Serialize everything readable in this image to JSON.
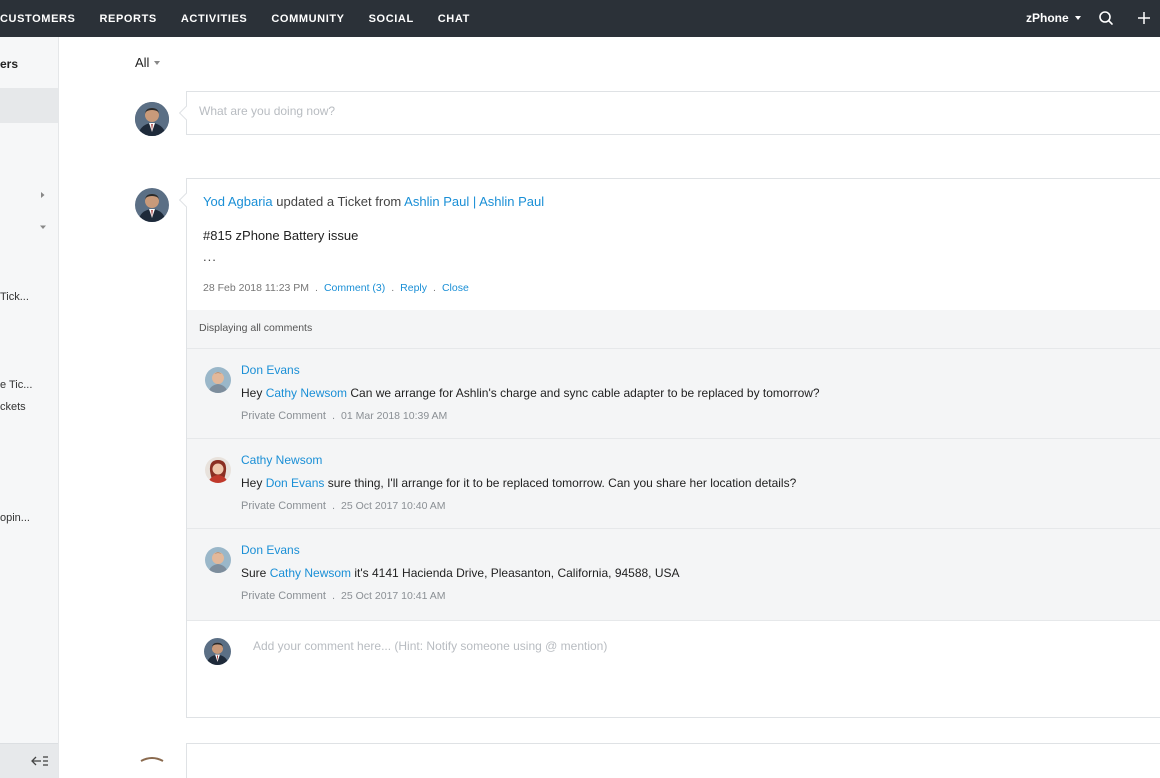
{
  "nav": {
    "items": [
      "CUSTOMERS",
      "REPORTS",
      "ACTIVITIES",
      "COMMUNITY",
      "SOCIAL",
      "CHAT"
    ],
    "brand": "zPhone",
    "icons": [
      "search-icon",
      "plus-icon"
    ]
  },
  "sidebar": {
    "title": "ers",
    "items": [
      "Tick...",
      "e Tic...",
      "ckets",
      "opin..."
    ],
    "collapse_icon": "collapse-sidebar-icon"
  },
  "filter": {
    "label": "All"
  },
  "composer": {
    "placeholder": "What are you doing now?"
  },
  "feed": {
    "actor": "Yod Agbaria",
    "action": " updated a Ticket from ",
    "contact": "Ashlin Paul",
    "separator": " | ",
    "account": "Ashlin Paul",
    "subject": "#815 zPhone Battery issue",
    "ellipsis": "...",
    "timestamp": "28 Feb 2018 11:23 PM",
    "dot": ".",
    "comment_link": "Comment (3)",
    "reply_link": "Reply",
    "close_link": "Close",
    "comments_label": "Displaying all comments",
    "comments": [
      {
        "author": "Don Evans",
        "prefix": "Hey ",
        "mention": "Cathy Newsom",
        "text": " Can we arrange for Ashlin's charge and sync cable adapter to be replaced by tomorrow?",
        "visibility": "Private Comment",
        "dot": ".",
        "time": "01 Mar 2018 10:39 AM"
      },
      {
        "author": "Cathy Newsom",
        "prefix": "Hey ",
        "mention": "Don Evans",
        "text": " sure thing, I'll arrange for it to be replaced tomorrow. Can you share her location details?",
        "visibility": "Private Comment",
        "dot": ".",
        "time": "25 Oct 2017 10:40 AM"
      },
      {
        "author": "Don Evans",
        "prefix": "Sure ",
        "mention": "Cathy Newsom",
        "text": " it's 4141 Hacienda Drive, Pleasanton, California, 94588, USA",
        "visibility": "Private Comment",
        "dot": ".",
        "time": "25 Oct 2017 10:41 AM"
      }
    ],
    "reply_placeholder": "Add your comment here... (Hint: Notify someone using @ mention)"
  },
  "colors": {
    "topbar": "#2b3138",
    "link": "#1a8fd6",
    "comments_bg": "#f4f5f6"
  }
}
